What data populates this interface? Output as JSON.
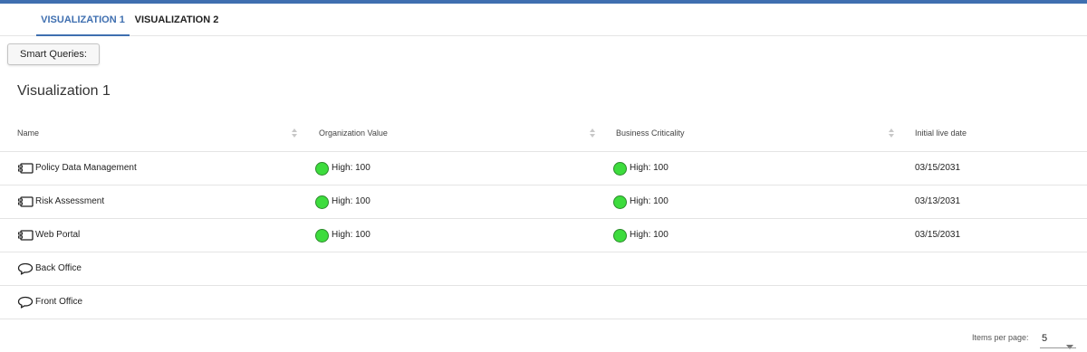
{
  "tabs": [
    {
      "label": "VISUALIZATION 1",
      "active": true
    },
    {
      "label": "VISUALIZATION 2",
      "active": false
    }
  ],
  "toolbar": {
    "smart_queries_label": "Smart Queries:"
  },
  "page": {
    "title": "Visualization 1"
  },
  "table": {
    "columns": [
      "Name",
      "Organization Value",
      "Business Criticality",
      "Initial live date"
    ],
    "rows": [
      {
        "icon": "application-icon",
        "name": "Policy Data Management",
        "org_value": "High: 100",
        "criticality": "High: 100",
        "date": "03/15/2031"
      },
      {
        "icon": "application-icon",
        "name": "Risk Assessment",
        "org_value": "High: 100",
        "criticality": "High: 100",
        "date": "03/13/2031"
      },
      {
        "icon": "application-icon",
        "name": "Web Portal",
        "org_value": "High: 100",
        "criticality": "High: 100",
        "date": "03/15/2031"
      },
      {
        "icon": "capability-icon",
        "name": "Back Office",
        "org_value": "",
        "criticality": "",
        "date": ""
      },
      {
        "icon": "capability-icon",
        "name": "Front Office",
        "org_value": "",
        "criticality": "",
        "date": ""
      }
    ]
  },
  "pagination": {
    "items_per_page_label": "Items per page:",
    "items_per_page_value": "5"
  },
  "colors": {
    "accent": "#3f6fb0",
    "status_high": "#3ddc3d"
  }
}
